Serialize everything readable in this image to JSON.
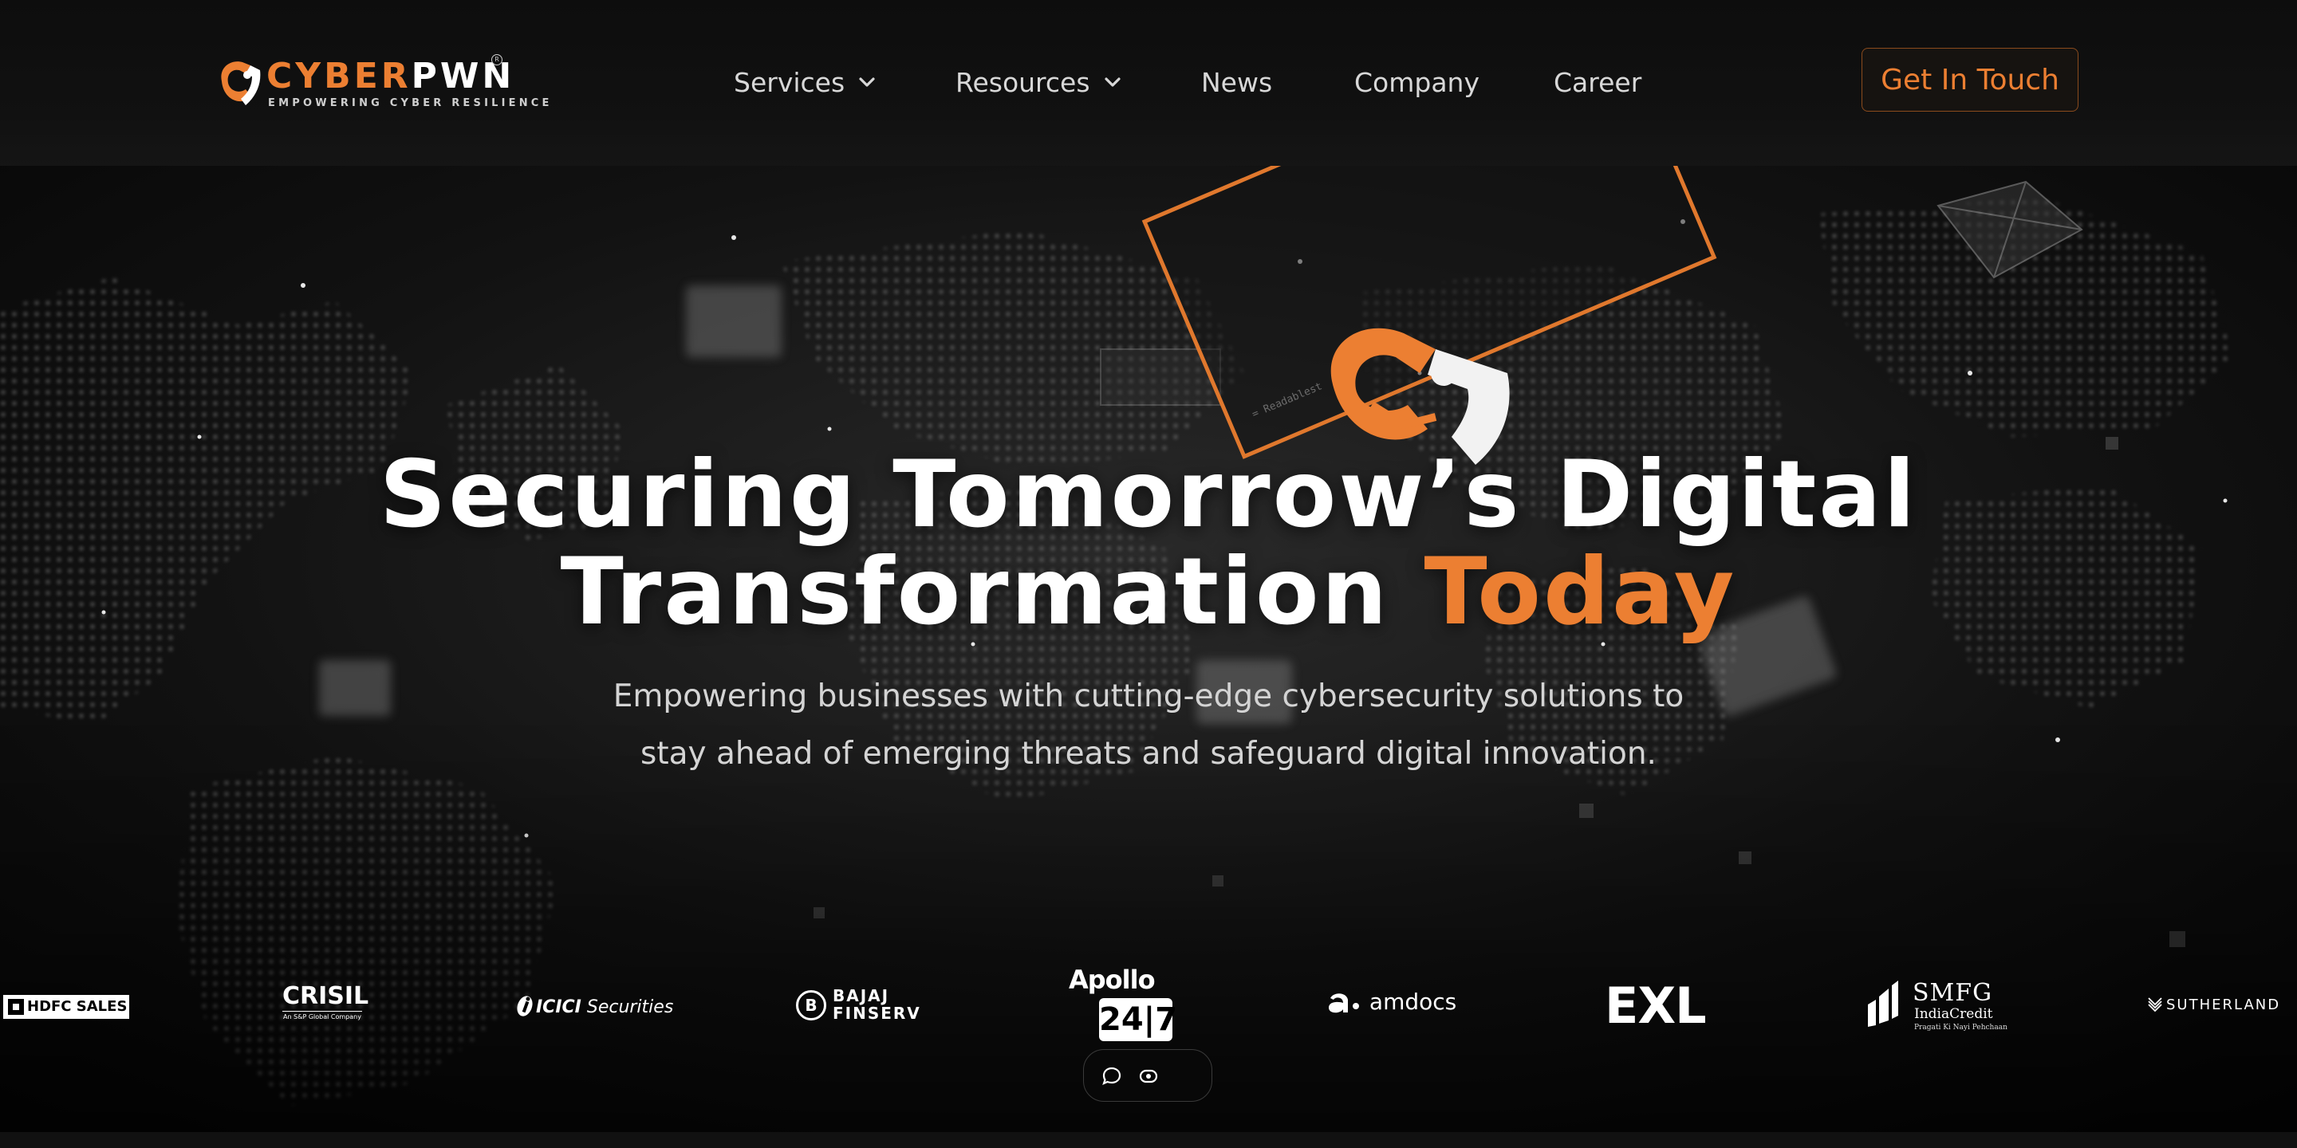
{
  "brand": {
    "name_part1": "CYBER",
    "name_part2": "PWN",
    "tagline": "EMPOWERING CYBER RESILIENCE",
    "registered_mark": "R"
  },
  "nav": {
    "items": [
      {
        "label": "Services",
        "has_dropdown": true
      },
      {
        "label": "Resources",
        "has_dropdown": true
      },
      {
        "label": "News",
        "has_dropdown": false
      },
      {
        "label": "Company",
        "has_dropdown": false
      },
      {
        "label": "Career",
        "has_dropdown": false
      }
    ],
    "cta_label": "Get In Touch"
  },
  "hero": {
    "title_line1": "Securing Tomorrow’s Digital",
    "title_line2_main": "Transformation ",
    "title_line2_accent": "Today",
    "subtitle_line1": "Empowering businesses with cutting-edge cybersecurity solutions to",
    "subtitle_line2": "stay ahead of emerging threats and safeguard digital innovation."
  },
  "clients": {
    "hdfc": "HDFC SALES",
    "crisil": "CRISIL",
    "crisil_sub": "An S&P Global Company",
    "icici_bold": "ICICI",
    "icici_rest": " Securities",
    "bajaj_line1": "BAJAJ",
    "bajaj_line2": "FINSERV",
    "bajaj_mark": "B",
    "apollo_name": "Apollo",
    "apollo_num": "24|7",
    "amdocs": "amdocs",
    "exl": "EXL",
    "smfg_line1": "SMFG",
    "smfg_line2": "IndiaCredit",
    "smfg_line3": "Pragati Ki Nayi Pehchaan",
    "sutherland": "SUTHERLAND"
  },
  "icons": {
    "chevron": "chevron-down-icon",
    "chat": "chat-bubble-icon",
    "eye": "eye-icon"
  },
  "colors": {
    "accent": "#ec7f32",
    "background": "#0b0b0b",
    "text": "#ffffff",
    "muted_text": "#d4d4d4"
  }
}
